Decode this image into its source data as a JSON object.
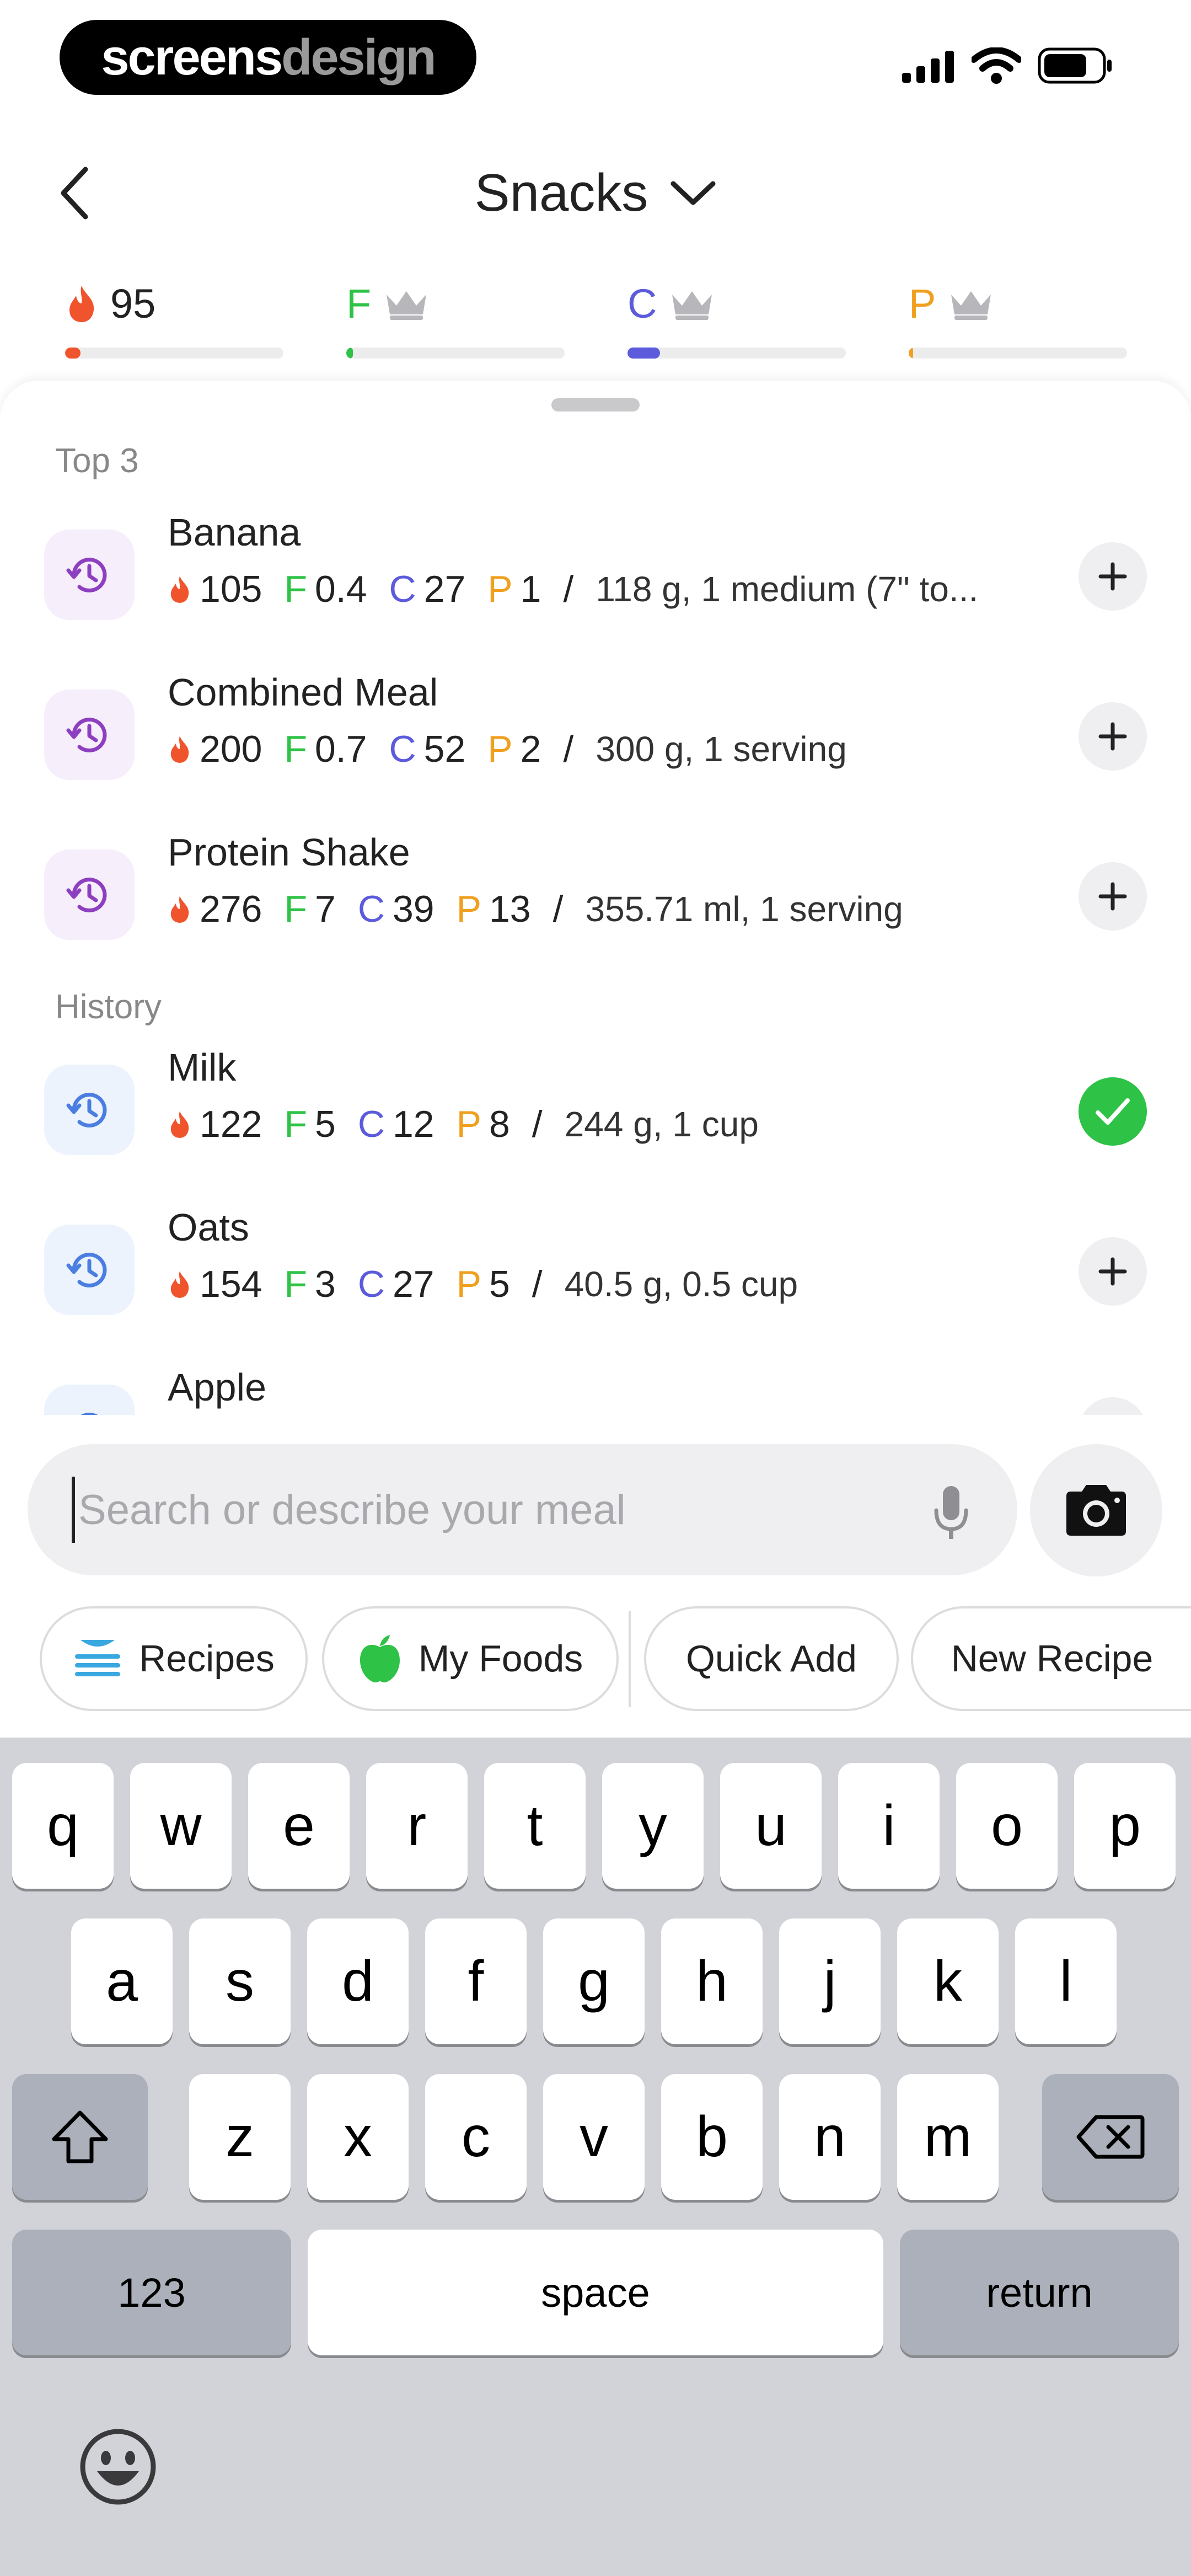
{
  "status_bar": {
    "brand_part1": "screens",
    "brand_part2": "design"
  },
  "header": {
    "title": "Snacks"
  },
  "summary": {
    "calories": "95",
    "fat_label": "F",
    "carbs_label": "C",
    "protein_label": "P",
    "progress": {
      "calories": 0.07,
      "fat": 0.03,
      "carbs": 0.15,
      "protein": 0.02
    }
  },
  "sections": {
    "top": "Top 3",
    "history": "History"
  },
  "items": [
    {
      "name": "Banana",
      "cal": "105",
      "f": "0.4",
      "c": "27",
      "p": "1",
      "serving": "118 g, 1 medium (7\" to...",
      "action": "add",
      "group": "top"
    },
    {
      "name": "Combined Meal",
      "cal": "200",
      "f": "0.7",
      "c": "52",
      "p": "2",
      "serving": "300 g, 1 serving",
      "action": "add",
      "group": "top"
    },
    {
      "name": "Protein Shake",
      "cal": "276",
      "f": "7",
      "c": "39",
      "p": "13",
      "serving": "355.71 ml, 1 serving",
      "action": "add",
      "group": "top"
    },
    {
      "name": "Milk",
      "cal": "122",
      "f": "5",
      "c": "12",
      "p": "8",
      "serving": "244 g, 1 cup",
      "action": "added",
      "group": "history"
    },
    {
      "name": "Oats",
      "cal": "154",
      "f": "3",
      "c": "27",
      "p": "5",
      "serving": "40.5 g, 0.5 cup",
      "action": "add",
      "group": "history"
    },
    {
      "name": "Apple",
      "group": "history",
      "action": "add"
    }
  ],
  "search": {
    "placeholder": "Search or describe your meal"
  },
  "chips": {
    "recipes": "Recipes",
    "my_foods": "My Foods",
    "quick_add": "Quick Add",
    "new_recipe": "New Recipe"
  },
  "keyboard": {
    "row1": [
      "q",
      "w",
      "e",
      "r",
      "t",
      "y",
      "u",
      "i",
      "o",
      "p"
    ],
    "row2": [
      "a",
      "s",
      "d",
      "f",
      "g",
      "h",
      "j",
      "k",
      "l"
    ],
    "row3": [
      "z",
      "x",
      "c",
      "v",
      "b",
      "n",
      "m"
    ],
    "numbers": "123",
    "space": "space",
    "return": "return"
  },
  "colors": {
    "calorie": "#f0542d",
    "fat": "#2ec246",
    "carbs": "#5b5bdc",
    "protein": "#f0a020",
    "top_icon": "#8e3fc0",
    "history_icon": "#4a7ee0"
  }
}
